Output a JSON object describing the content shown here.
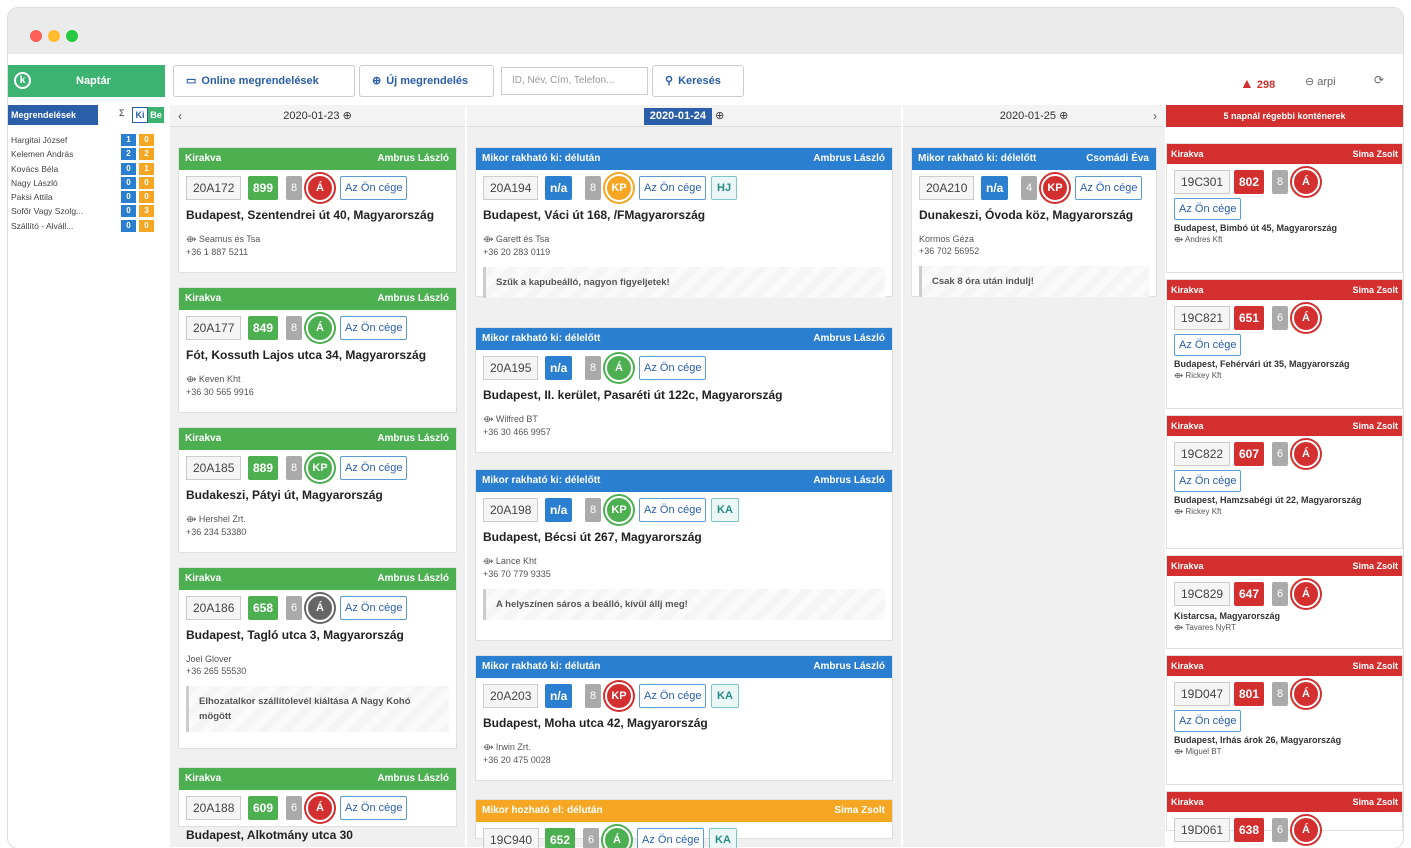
{
  "window": {
    "dots": [
      "#ff5f57",
      "#febc2e",
      "#28c840"
    ]
  },
  "toolbar": {
    "calendar": "Naptár",
    "logo": "k",
    "online": "Online megrendelések",
    "new": "Új megrendelés",
    "search_placeholder": "ID, Név, Cím, Telefon...",
    "search": "Keresés",
    "alerts": "298",
    "user": "arpi"
  },
  "sidebar": {
    "title": "Megrendelések",
    "sigma": "Σ",
    "ki": "Ki",
    "be": "Be",
    "drivers": [
      {
        "name": "Hargitai József",
        "ki": "1",
        "be": "0"
      },
      {
        "name": "Kelemen András",
        "ki": "2",
        "be": "2"
      },
      {
        "name": "Kovács Béla",
        "ki": "0",
        "be": "1"
      },
      {
        "name": "Nagy László",
        "ki": "0",
        "be": "0"
      },
      {
        "name": "Paksi Attila",
        "ki": "0",
        "be": "0"
      },
      {
        "name": "Sofőr Vagy Szolg...",
        "ki": "0",
        "be": "3"
      },
      {
        "name": "Szállító - Alváll...",
        "ki": "0",
        "be": "0"
      }
    ]
  },
  "columns": [
    {
      "date": "2020-01-23"
    },
    {
      "date": "2020-01-24"
    },
    {
      "date": "2020-01-25"
    }
  ],
  "old_header": "5 napnál régebbi konténerek",
  "col1": [
    {
      "status": "Kirakva",
      "driver": "Ambrus László",
      "id": "20A172",
      "num": "899",
      "count": "8",
      "circle": "Á",
      "company": "Az Ön cége",
      "addr": "Budapest, Szentendrei út 40, Magyarország",
      "client": "Seamus és Tsa",
      "phone": "+36 1 887 5211"
    },
    {
      "status": "Kirakva",
      "driver": "Ambrus László",
      "id": "20A177",
      "num": "849",
      "count": "8",
      "circle": "Á",
      "company": "Az Ön cége",
      "addr": "Fót, Kossuth Lajos utca 34, Magyarország",
      "client": "Keven Kht",
      "phone": "+36 30 565 9916"
    },
    {
      "status": "Kirakva",
      "driver": "Ambrus László",
      "id": "20A185",
      "num": "889",
      "count": "8",
      "circle": "KP",
      "company": "Az Ön cége",
      "addr": "Budakeszi, Pátyi út, Magyarország",
      "client": "Hershel Zrt.",
      "phone": "+36 234 53380"
    },
    {
      "status": "Kirakva",
      "driver": "Ambrus László",
      "id": "20A186",
      "num": "658",
      "count": "6",
      "circle": "Á",
      "company": "Az Ön cége",
      "addr": "Budapest, Tagló utca 3, Magyarország",
      "client": "Joel Glover",
      "phone": "+36 265 55530",
      "note": "Elhozatalkor szállítólevél kiáltása A Nagy Kohó mögött"
    },
    {
      "status": "Kirakva",
      "driver": "Ambrus László",
      "id": "20A188",
      "num": "609",
      "count": "6",
      "circle": "Á",
      "company": "Az Ön cége",
      "addr": "Budapest, Alkotmány utca 30"
    }
  ],
  "col2": [
    {
      "status": "Mikor rakható ki: délután",
      "driver": "Ambrus László",
      "id": "20A194",
      "num": "n/a",
      "count": "8",
      "circle": "KP",
      "company": "Az Ön cége",
      "tag": "HJ",
      "addr": "Budapest, Váci út 168, /FMagyarország",
      "client": "Garett és Tsa",
      "phone": "+36 20 283 0119",
      "note": "Szűk a kapubeálló, nagyon figyeljetek!"
    },
    {
      "status": "Mikor rakható ki: délelőtt",
      "driver": "Ambrus László",
      "id": "20A195",
      "num": "n/a",
      "count": "8",
      "circle": "Á",
      "company": "Az Ön cége",
      "addr": "Budapest, II. kerület, Pasaréti út 122c, Magyarország",
      "client": "Wilfred BT",
      "phone": "+36 30 466 9957"
    },
    {
      "status": "Mikor rakható ki: délelőtt",
      "driver": "Ambrus László",
      "id": "20A198",
      "num": "n/a",
      "count": "8",
      "circle": "KP",
      "company": "Az Ön cége",
      "tag": "KA",
      "addr": "Budapest, Bécsi út 267, Magyarország",
      "client": "Lance Kht",
      "phone": "+36 70 779 9335",
      "note": "A helyszínen sáros a beálló, kívül állj meg!"
    },
    {
      "status": "Mikor rakható ki: délután",
      "driver": "Ambrus László",
      "id": "20A203",
      "num": "n/a",
      "count": "8",
      "circle": "KP",
      "company": "Az Ön cége",
      "tag": "KA",
      "addr": "Budapest, Moha utca 42, Magyarország",
      "client": "Irwin Zrt.",
      "phone": "+36 20 475 0028"
    },
    {
      "status": "Mikor hozható el: délután",
      "driver": "Sima Zsolt",
      "id": "19C940",
      "num": "652",
      "count": "6",
      "circle": "Á",
      "company": "Az Ön cége",
      "tag": "KA"
    }
  ],
  "col3": [
    {
      "status": "Mikor rakható ki: délelőtt",
      "driver": "Csomádi Éva",
      "id": "20A210",
      "num": "n/a",
      "count": "4",
      "circle": "KP",
      "company": "Az Ön cége",
      "addr": "Dunakeszi, Óvoda köz, Magyarország",
      "client": "Kormos Géza",
      "phone": "+36 702 56952",
      "note": "Csak 8 óra után indulj!"
    }
  ],
  "old": [
    {
      "status": "Kirakva",
      "driver": "Sima Zsolt",
      "id": "19C301",
      "num": "802",
      "count": "8",
      "circle": "Á",
      "company": "Az Ön cége",
      "addr": "Budapest, Bimbó út 45, Magyarország",
      "client": "Andres Kft"
    },
    {
      "status": "Kirakva",
      "driver": "Sima Zsolt",
      "id": "19C821",
      "num": "651",
      "count": "6",
      "circle": "Á",
      "company": "Az Ön cége",
      "addr": "Budapest, Fehérvári út 35, Magyarország",
      "client": "Rickey Kft"
    },
    {
      "status": "Kirakva",
      "driver": "Sima Zsolt",
      "id": "19C822",
      "num": "607",
      "count": "6",
      "circle": "Á",
      "company": "Az Ön cége",
      "addr": "Budapest, Hamzsabégi út 22, Magyarország",
      "client": "Rickey Kft"
    },
    {
      "status": "Kirakva",
      "driver": "Sima Zsolt",
      "id": "19C829",
      "num": "647",
      "count": "6",
      "circle": "Á",
      "addr": "Kistarcsa, Magyarország",
      "client": "Tavares NyRT"
    },
    {
      "status": "Kirakva",
      "driver": "Sima Zsolt",
      "id": "19D047",
      "num": "801",
      "count": "8",
      "circle": "Á",
      "company": "Az Ön cége",
      "addr": "Budapest, Irhás árok 26, Magyarország",
      "client": "Miguel BT"
    },
    {
      "status": "Kirakva",
      "driver": "Sima Zsolt",
      "id": "19D061",
      "num": "638",
      "count": "6",
      "circle": "Á"
    }
  ]
}
